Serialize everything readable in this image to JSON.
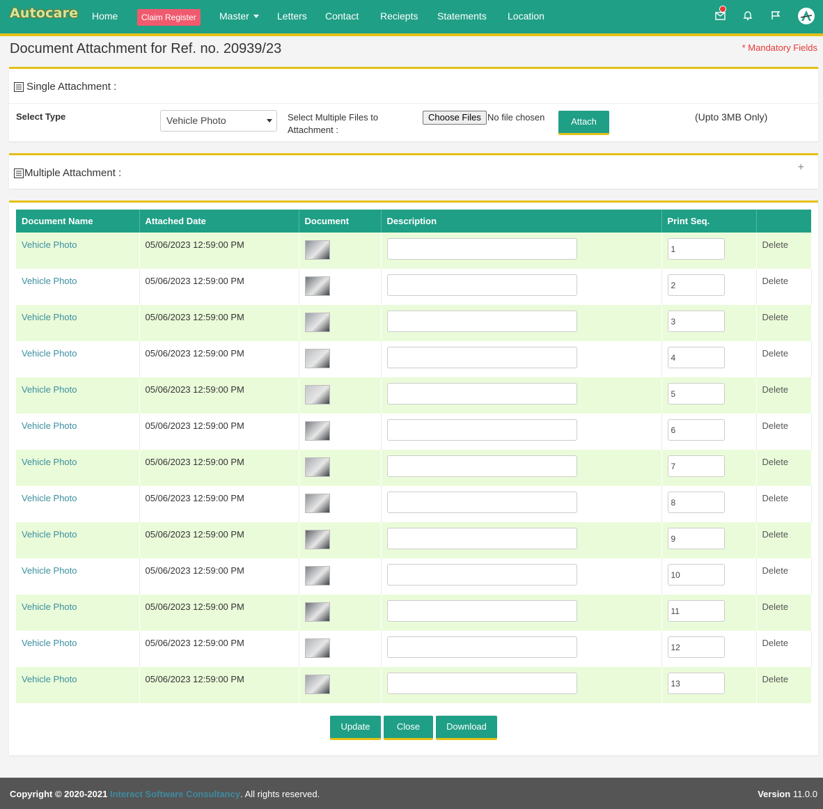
{
  "nav": {
    "logo": "Autocare",
    "home": "Home",
    "claim_register": "Claim Register",
    "master": "Master",
    "letters": "Letters",
    "contact": "Contact",
    "receipts": "Reciepts",
    "statements": "Statements",
    "location": "Location"
  },
  "page": {
    "title": "Document Attachment for Ref. no. 20939/23",
    "mandatory": "* Mandatory Fields"
  },
  "single": {
    "heading": "Single Attachment :",
    "select_type_label": "Select Type",
    "select_value": "Vehicle Photo",
    "multi_files_label_1": "Select Multiple Files to",
    "multi_files_label_2": "Attachment :",
    "choose_files": "Choose Files",
    "no_file": "No file chosen",
    "attach": "Attach",
    "size_note": "(Upto 3MB Only)"
  },
  "multiple": {
    "heading": "Multiple Attachment :",
    "expand": "+"
  },
  "table": {
    "headers": [
      "Document Name",
      "Attached Date",
      "Document",
      "Description",
      "Print Seq.",
      ""
    ],
    "rows": [
      {
        "name": "Vehicle Photo",
        "date": "05/06/2023 12:59:00 PM",
        "seq": "1",
        "action": "Delete"
      },
      {
        "name": "Vehicle Photo",
        "date": "05/06/2023 12:59:00 PM",
        "seq": "2",
        "action": "Delete"
      },
      {
        "name": "Vehicle Photo",
        "date": "05/06/2023 12:59:00 PM",
        "seq": "3",
        "action": "Delete"
      },
      {
        "name": "Vehicle Photo",
        "date": "05/06/2023 12:59:00 PM",
        "seq": "4",
        "action": "Delete"
      },
      {
        "name": "Vehicle Photo",
        "date": "05/06/2023 12:59:00 PM",
        "seq": "5",
        "action": "Delete"
      },
      {
        "name": "Vehicle Photo",
        "date": "05/06/2023 12:59:00 PM",
        "seq": "6",
        "action": "Delete"
      },
      {
        "name": "Vehicle Photo",
        "date": "05/06/2023 12:59:00 PM",
        "seq": "7",
        "action": "Delete"
      },
      {
        "name": "Vehicle Photo",
        "date": "05/06/2023 12:59:00 PM",
        "seq": "8",
        "action": "Delete"
      },
      {
        "name": "Vehicle Photo",
        "date": "05/06/2023 12:59:00 PM",
        "seq": "9",
        "action": "Delete"
      },
      {
        "name": "Vehicle Photo",
        "date": "05/06/2023 12:59:00 PM",
        "seq": "10",
        "action": "Delete"
      },
      {
        "name": "Vehicle Photo",
        "date": "05/06/2023 12:59:00 PM",
        "seq": "11",
        "action": "Delete"
      },
      {
        "name": "Vehicle Photo",
        "date": "05/06/2023 12:59:00 PM",
        "seq": "12",
        "action": "Delete"
      },
      {
        "name": "Vehicle Photo",
        "date": "05/06/2023 12:59:00 PM",
        "seq": "13",
        "action": "Delete"
      }
    ]
  },
  "actions": {
    "update": "Update",
    "close": "Close",
    "download": "Download"
  },
  "footer": {
    "copyright": "Copyright © 2020-2021",
    "company": "Interact Software Consultancy",
    "rights": ". All rights reserved.",
    "version_label": "Version",
    "version_number": "11.0.0"
  },
  "colors": {
    "primary": "#1f9f86",
    "accent": "#e5c017",
    "row_alt": "#eafbd9",
    "claim_button": "#f05a6e",
    "mandatory": "#e53935"
  }
}
